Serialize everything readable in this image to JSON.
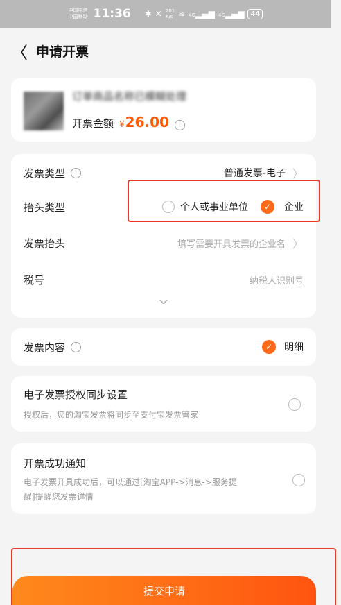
{
  "status_bar": {
    "carrier_1": "中国电信",
    "carrier_2": "中国移动",
    "time": "11:36",
    "net_speed_value": "201",
    "net_speed_unit": "K/s",
    "signal_1": "4G",
    "signal_2": "4G",
    "battery": "44"
  },
  "header": {
    "title": "申请开票"
  },
  "product": {
    "name": "订单商品名称已模糊处理",
    "amount_label": "开票金额",
    "currency": "¥",
    "amount": "26.00"
  },
  "form": {
    "invoice_type": {
      "label": "发票类型",
      "value": "普通发票-电子"
    },
    "title_type": {
      "label": "抬头类型",
      "options": [
        {
          "label": "个人或事业单位",
          "selected": false
        },
        {
          "label": "企业",
          "selected": true
        }
      ]
    },
    "invoice_title": {
      "label": "发票抬头",
      "placeholder": "填写需要开具发票的企业名"
    },
    "tax_id": {
      "label": "税号",
      "placeholder": "纳税人识别号"
    }
  },
  "invoice_content": {
    "label": "发票内容",
    "option": "明细"
  },
  "sync_settings": {
    "title": "电子发票授权同步设置",
    "description": "授权后，您的淘宝发票将同步至支付宝发票管家"
  },
  "success_notify": {
    "title": "开票成功通知",
    "description_line1": "电子发票开具成功后，可以通过[淘宝APP->消息->服务提",
    "description_line2": "醒]提醒您发票详情"
  },
  "submit": {
    "label": "提交申请"
  },
  "colors": {
    "accent": "#ff6a1a",
    "highlight_border": "#e83a2a",
    "background": "#f4f4f4"
  }
}
